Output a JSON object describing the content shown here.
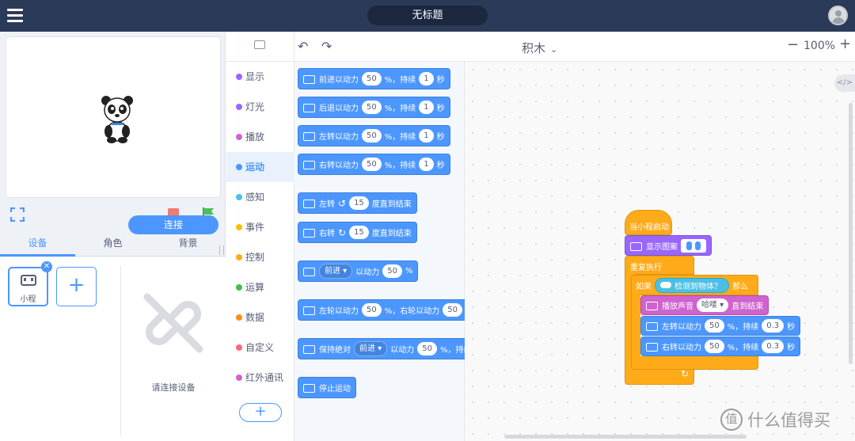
{
  "app": {
    "title": "无标题"
  },
  "colors": {
    "topbar": "#2b3a58",
    "accent": "#4c97ff",
    "motion": "#4c97ff",
    "looks": "#9966ff",
    "sound": "#cf63cf",
    "control": "#ffab19",
    "sensing": "#4cbfe6"
  },
  "stage_controls": {
    "fullscreen_icon": "fullscreen-icon",
    "stop_icon": "stop-icon",
    "go_icon": "green-flag-icon"
  },
  "left_tabs": [
    "设备",
    "角色",
    "背景"
  ],
  "devices": {
    "items": [
      {
        "name": "小程"
      }
    ],
    "add_label": "+",
    "empty_text": "请连接设备",
    "connect_label": "连接"
  },
  "categories": [
    {
      "label": "显示",
      "color": "#9966ff"
    },
    {
      "label": "灯光",
      "color": "#9966ff"
    },
    {
      "label": "播放",
      "color": "#cf63cf"
    },
    {
      "label": "运动",
      "color": "#4c97ff",
      "active": true
    },
    {
      "label": "感知",
      "color": "#4cbfe6"
    },
    {
      "label": "事件",
      "color": "#ffbf00"
    },
    {
      "label": "控制",
      "color": "#ffab19"
    },
    {
      "label": "运算",
      "color": "#40bf4a"
    },
    {
      "label": "数据",
      "color": "#ff8c1a"
    },
    {
      "label": "自定义",
      "color": "#ff6680"
    },
    {
      "label": "红外通讯",
      "color": "#cf63cf"
    }
  ],
  "category_add": "+",
  "toolbar": {
    "view_mode": "积木",
    "zoom": "100%",
    "zoom_minus": "−",
    "zoom_plus": "+"
  },
  "palette": [
    {
      "parts": [
        "前进以动力",
        "50",
        "%，持续",
        "1",
        "秒"
      ]
    },
    {
      "parts": [
        "后退以动力",
        "50",
        "%，持续",
        "1",
        "秒"
      ]
    },
    {
      "parts": [
        "左转以动力",
        "50",
        "%，持续",
        "1",
        "秒"
      ]
    },
    {
      "parts": [
        "右转以动力",
        "50",
        "%，持续",
        "1",
        "秒"
      ]
    },
    {
      "parts": [
        "左转",
        "15",
        "度直到结束"
      ]
    },
    {
      "parts": [
        "右转",
        "15",
        "度直到结束"
      ]
    },
    {
      "parts": [
        "前进",
        "以动力",
        "50",
        "%"
      ]
    },
    {
      "parts": [
        "左轮以动力",
        "50",
        "%，右轮以动力",
        "50",
        "%"
      ]
    },
    {
      "parts": [
        "保持绝对",
        "前进",
        "以动力",
        "50",
        "%，持续",
        "1",
        "秒"
      ]
    },
    {
      "parts": [
        "停止运动"
      ]
    }
  ],
  "script": {
    "hat": "当小程启动",
    "show_image": "显示图案",
    "forever": "重复执行",
    "if_label": "如果",
    "condition": "检测到物体？",
    "then_label": "那么",
    "play_sound": {
      "label": "播放声音",
      "sound": "哈喽",
      "until": "直到结束"
    },
    "left_turn": {
      "label": "左转以动力",
      "power": "50",
      "mid": "%，持续",
      "secs": "0.3",
      "unit": "秒"
    },
    "right_turn": {
      "label": "右转以动力",
      "power": "50",
      "mid": "%，持续",
      "secs": "0.3",
      "unit": "秒"
    }
  },
  "watermark": {
    "logo_text": "值",
    "text": "什么值得买"
  }
}
